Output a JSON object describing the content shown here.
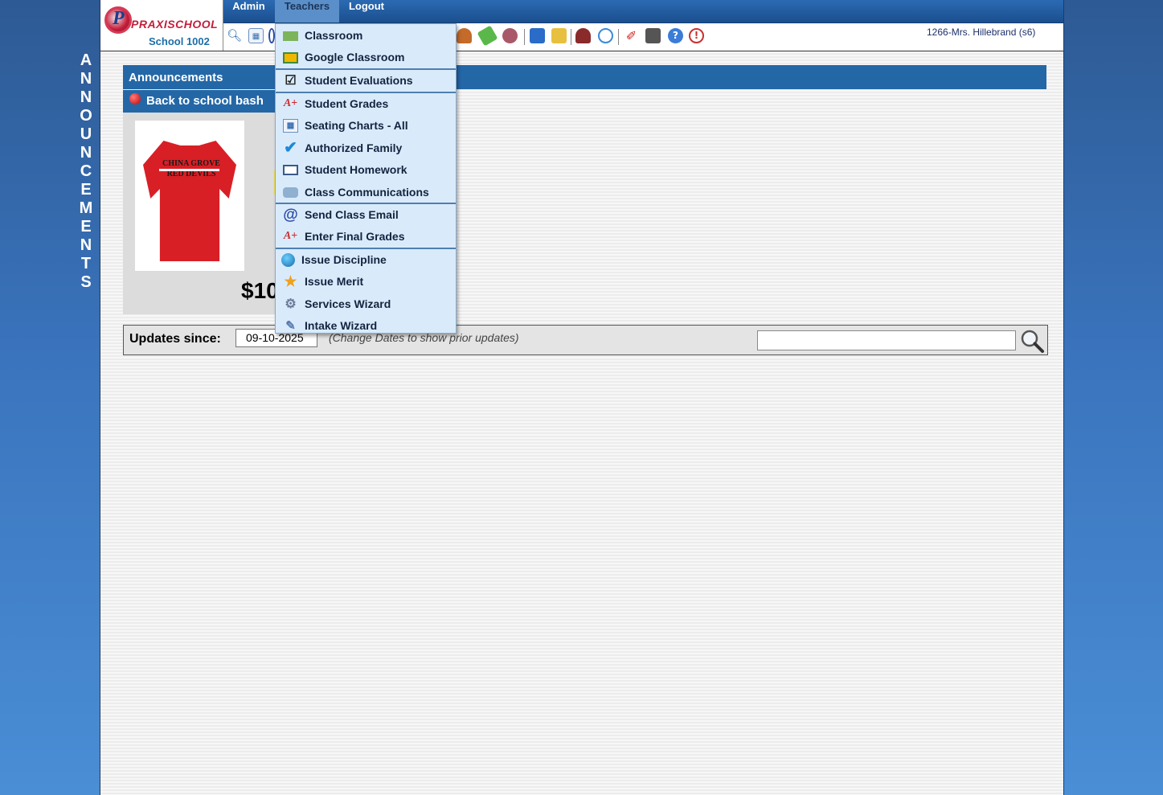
{
  "brand": {
    "logo_text": "PRAXISCHOOL",
    "school": "School 1002"
  },
  "menubar": {
    "items": [
      "Admin",
      "Teachers",
      "Logout"
    ],
    "active": "Teachers"
  },
  "user": "1266-Mrs. Hillebrand (s6)",
  "side_label": [
    "A",
    "N",
    "N",
    "O",
    "U",
    "N",
    "C",
    "E",
    "M",
    "E",
    "N",
    "T",
    "S"
  ],
  "announcements": {
    "title": "Announcements",
    "item_title": "Back to school bash",
    "shirt_text": "CHINA GROVE RED DEVILS",
    "price_partial": "$10"
  },
  "updates": {
    "label": "Updates since:",
    "date": "09-10-2025",
    "hint": "(Change Dates to show prior updates)",
    "search_placeholder": ""
  },
  "teachers_menu": [
    {
      "label": "Classroom",
      "icon": "classroom-icon"
    },
    {
      "label": "Google Classroom",
      "icon": "google-classroom-icon"
    },
    {
      "label": "Student Evaluations",
      "icon": "checkbox-icon"
    },
    {
      "label": "Student Grades",
      "icon": "grade-a-plus-icon"
    },
    {
      "label": "Seating Charts - All",
      "icon": "seating-chart-icon"
    },
    {
      "label": "Authorized Family",
      "icon": "checkmark-icon"
    },
    {
      "label": "Student Homework",
      "icon": "book-icon"
    },
    {
      "label": "Class Communications",
      "icon": "phone-icon"
    },
    {
      "label": "Send Class Email",
      "icon": "at-sign-icon"
    },
    {
      "label": "Enter Final Grades",
      "icon": "grade-a-plus-icon"
    },
    {
      "label": "Issue Discipline",
      "icon": "discipline-icon"
    },
    {
      "label": "Issue Merit",
      "icon": "medal-icon"
    },
    {
      "label": "Services Wizard",
      "icon": "services-icon"
    },
    {
      "label": "Intake Wizard",
      "icon": "intake-icon"
    }
  ],
  "colors": {
    "nav_bar": "#2467a6",
    "menu_bg": "#d9ebfb",
    "accent_red": "#c41e3a"
  }
}
